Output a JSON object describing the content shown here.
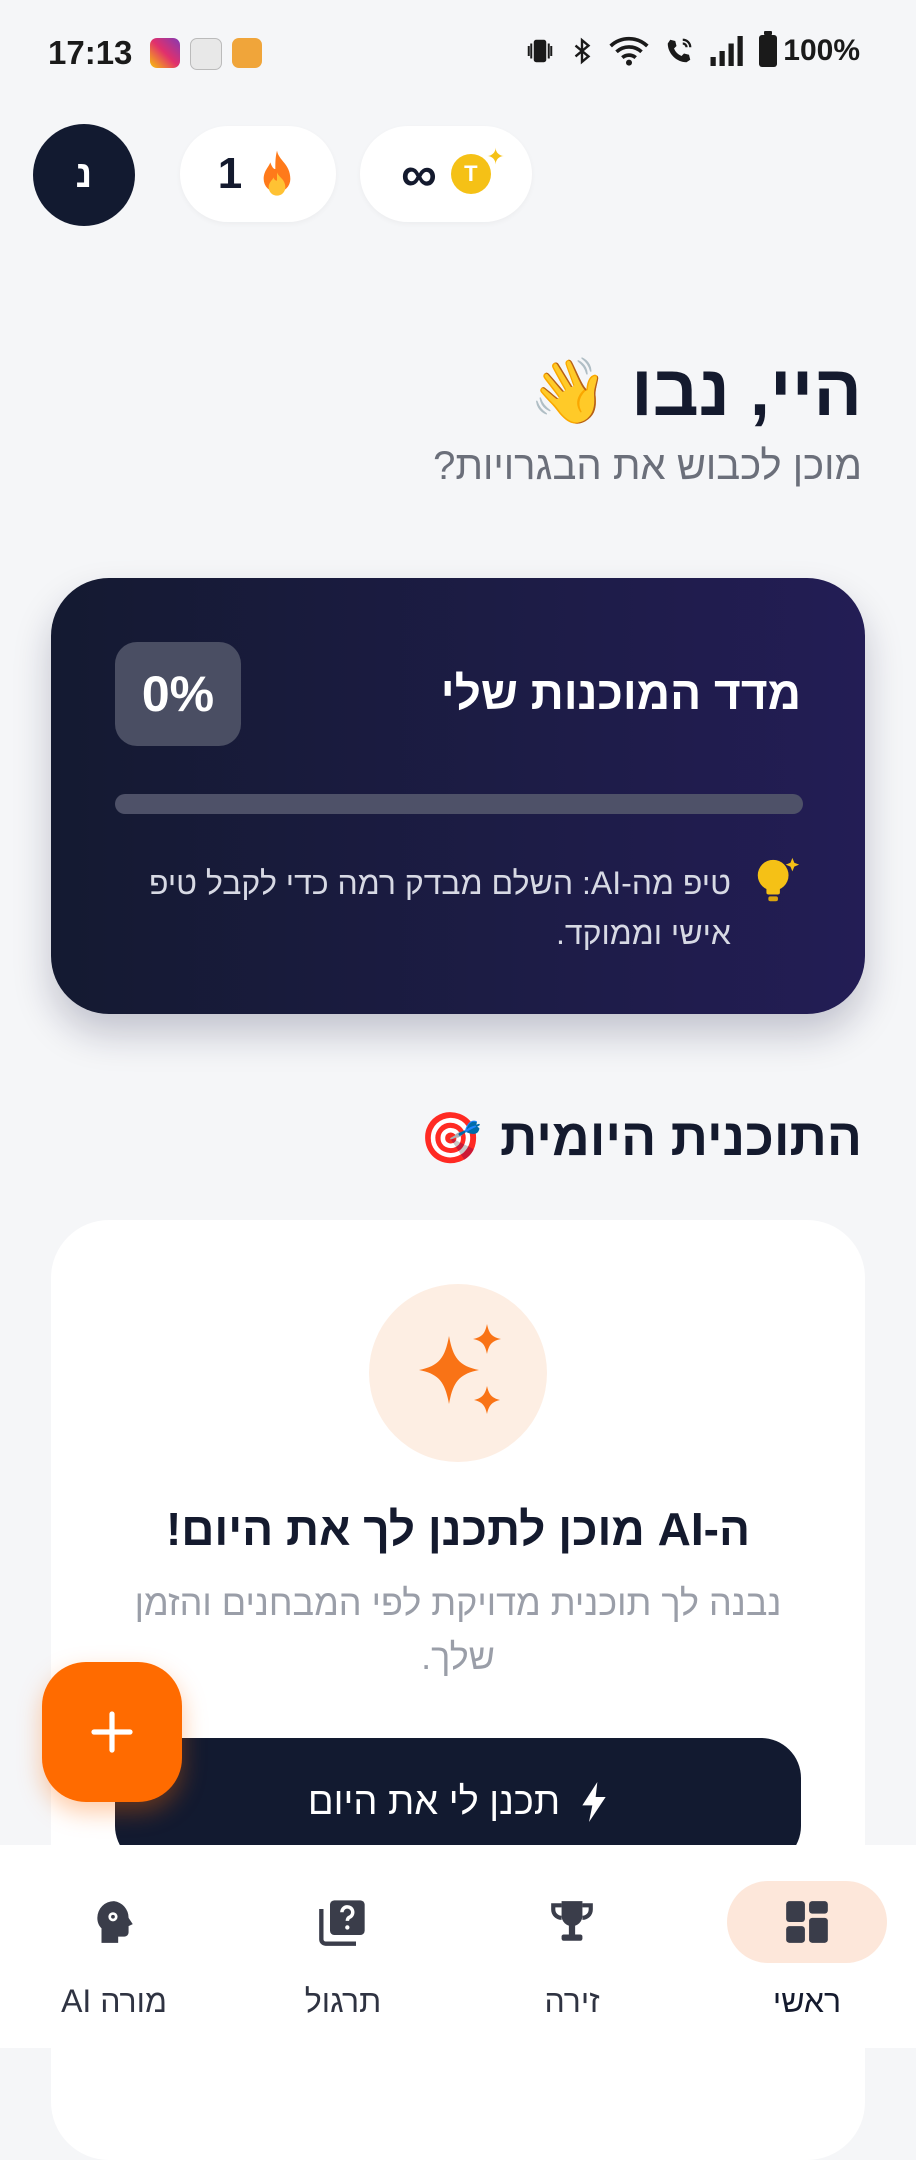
{
  "status_bar": {
    "time": "17:13",
    "battery": "100%",
    "icons": [
      "instagram-app-icon",
      "sudoku-app-icon",
      "translate-app-icon",
      "vibrate-icon",
      "bluetooth-icon",
      "wifi-icon",
      "wifi-call-icon",
      "signal-icon",
      "battery-icon"
    ]
  },
  "header": {
    "avatar_initial": "נ",
    "streak_count": "1",
    "streak_icon": "fire-emoji",
    "coins_value": "∞",
    "coin_letter": "T"
  },
  "greeting": {
    "title": "היי, נבו",
    "emoji": "👋",
    "subtitle": "מוכן לכבוש את הבגרויות?"
  },
  "readiness": {
    "title": "מדד המוכנות שלי",
    "percent_label": "0%",
    "progress_percent": 0,
    "tip": "טיפ מה-AI: השלם מבדק רמה כדי לקבל טיפ אישי וממוקד."
  },
  "daily_plan": {
    "section_title": "התוכנית היומית",
    "section_emoji": "🎯",
    "heading": "ה-AI מוכן לתכנן לך את היום!",
    "description": "נבנה לך תוכנית מדויקת לפי המבחנים והזמן שלך.",
    "button_label": "תכנן לי את היום"
  },
  "fab": {
    "icon": "plus-icon"
  },
  "bottom_nav": [
    {
      "label": "ראשי",
      "icon": "dashboard-icon",
      "active": true
    },
    {
      "label": "זירה",
      "icon": "trophy-icon",
      "active": false
    },
    {
      "label": "תרגול",
      "icon": "quiz-icon",
      "active": false
    },
    {
      "label": "מורה AI",
      "icon": "ai-teacher-icon",
      "active": false
    }
  ],
  "colors": {
    "accent": "#ff6b00",
    "dark": "#121a30",
    "card_gradient_start": "#141a31",
    "card_gradient_end": "#231d55",
    "background": "#f5f6f8"
  }
}
